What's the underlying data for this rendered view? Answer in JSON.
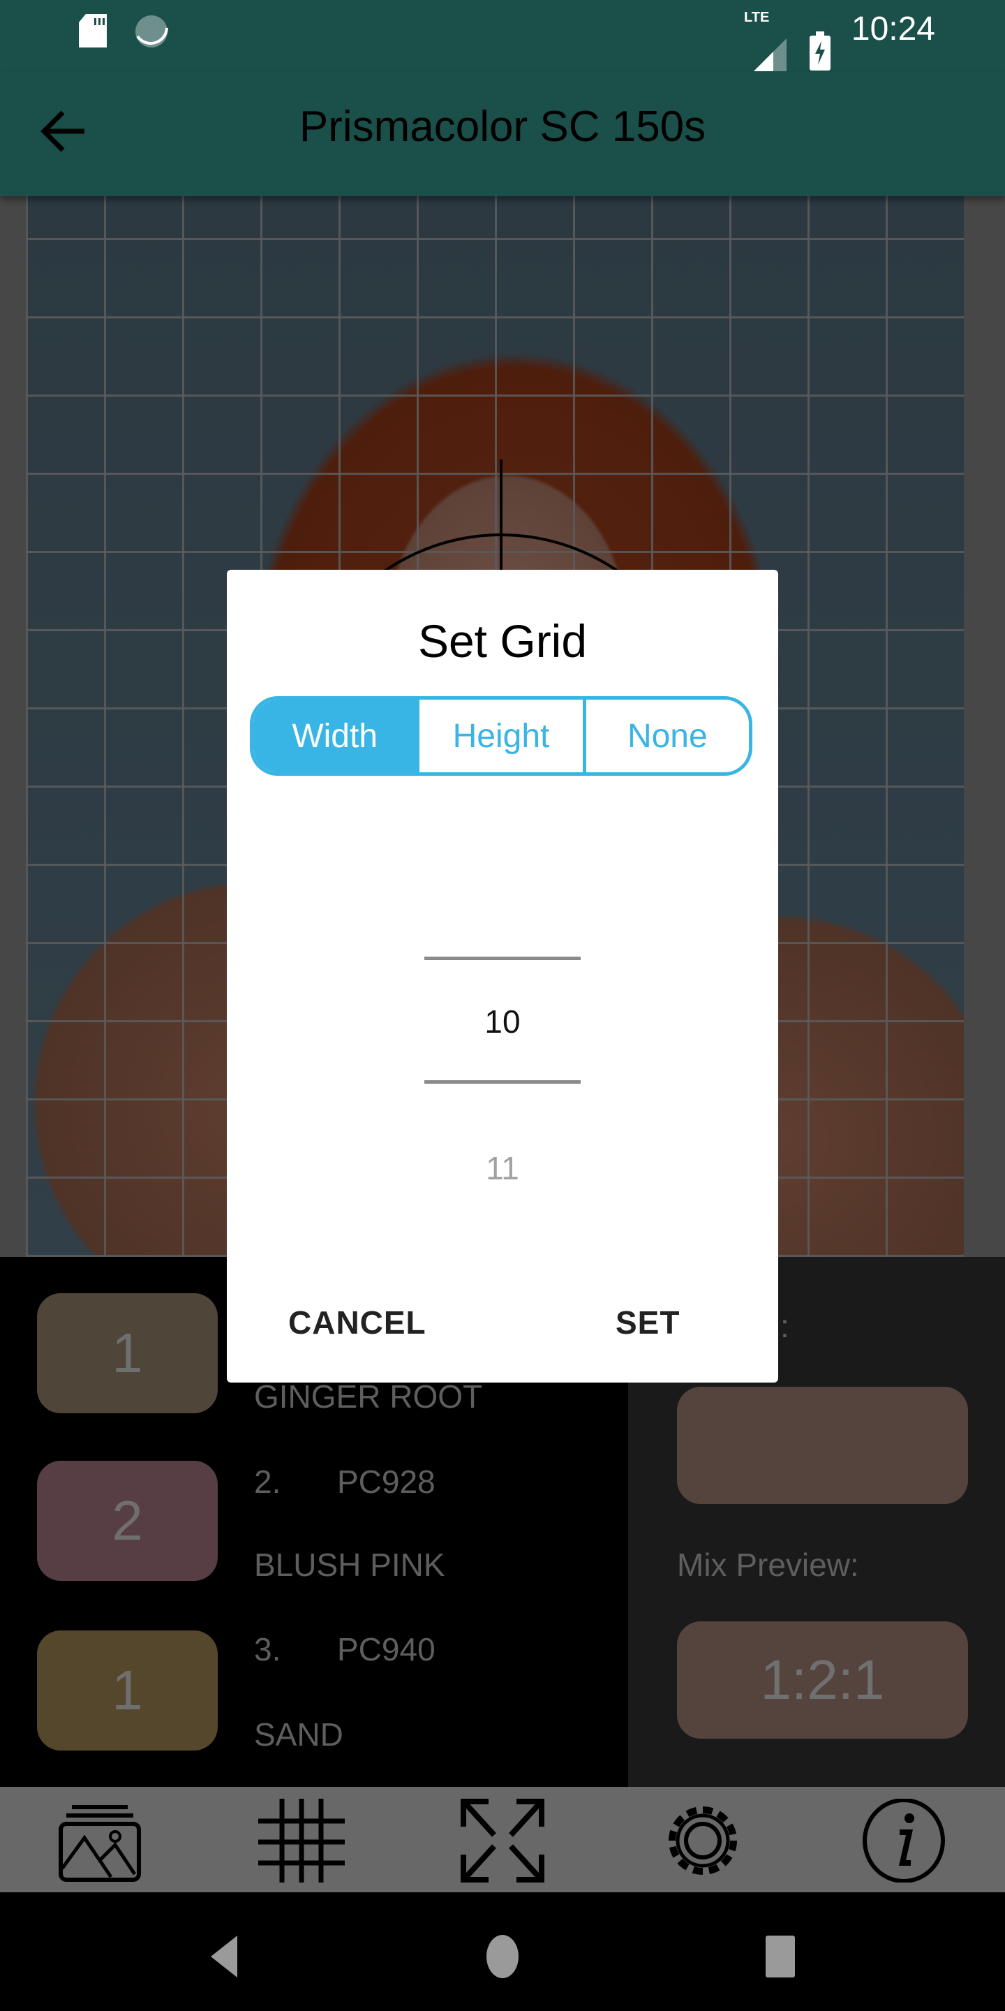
{
  "status_bar": {
    "time": "10:24",
    "network": "LTE",
    "icons": [
      "sd-card-icon",
      "sync-icon",
      "signal-icon",
      "battery-charging-icon"
    ]
  },
  "app_bar": {
    "title": "Prismacolor SC 150s",
    "back_icon": "arrow-left-icon"
  },
  "pencils": [
    {
      "count": "1",
      "code": "",
      "name": "GINGER ROOT",
      "color": "#4f4538"
    },
    {
      "count": "2",
      "number": "2.",
      "code": "PC928",
      "name": "BLUSH PINK",
      "color": "#563e44"
    },
    {
      "count": "1",
      "number": "3.",
      "code": "PC940",
      "name": "SAND",
      "color": "#54472c"
    }
  ],
  "right_panel": {
    "color_label_suffix": ":",
    "color_box": "#55443e",
    "mix_label": "Mix Preview:",
    "mix_ratio": "1:2:1"
  },
  "toolbar": {
    "icons": [
      "gallery-icon",
      "grid-icon",
      "fullscreen-icon",
      "settings-icon",
      "info-icon"
    ]
  },
  "dialog": {
    "title": "Set Grid",
    "segments": [
      {
        "label": "Width",
        "active": true
      },
      {
        "label": "Height",
        "active": false
      },
      {
        "label": "None",
        "active": false
      }
    ],
    "picker": {
      "selected": "10",
      "next": "11"
    },
    "cancel": "CANCEL",
    "set": "SET",
    "accent": "#38b5e5"
  },
  "nav": {
    "icons": [
      "back-icon",
      "home-icon",
      "recents-icon"
    ]
  }
}
